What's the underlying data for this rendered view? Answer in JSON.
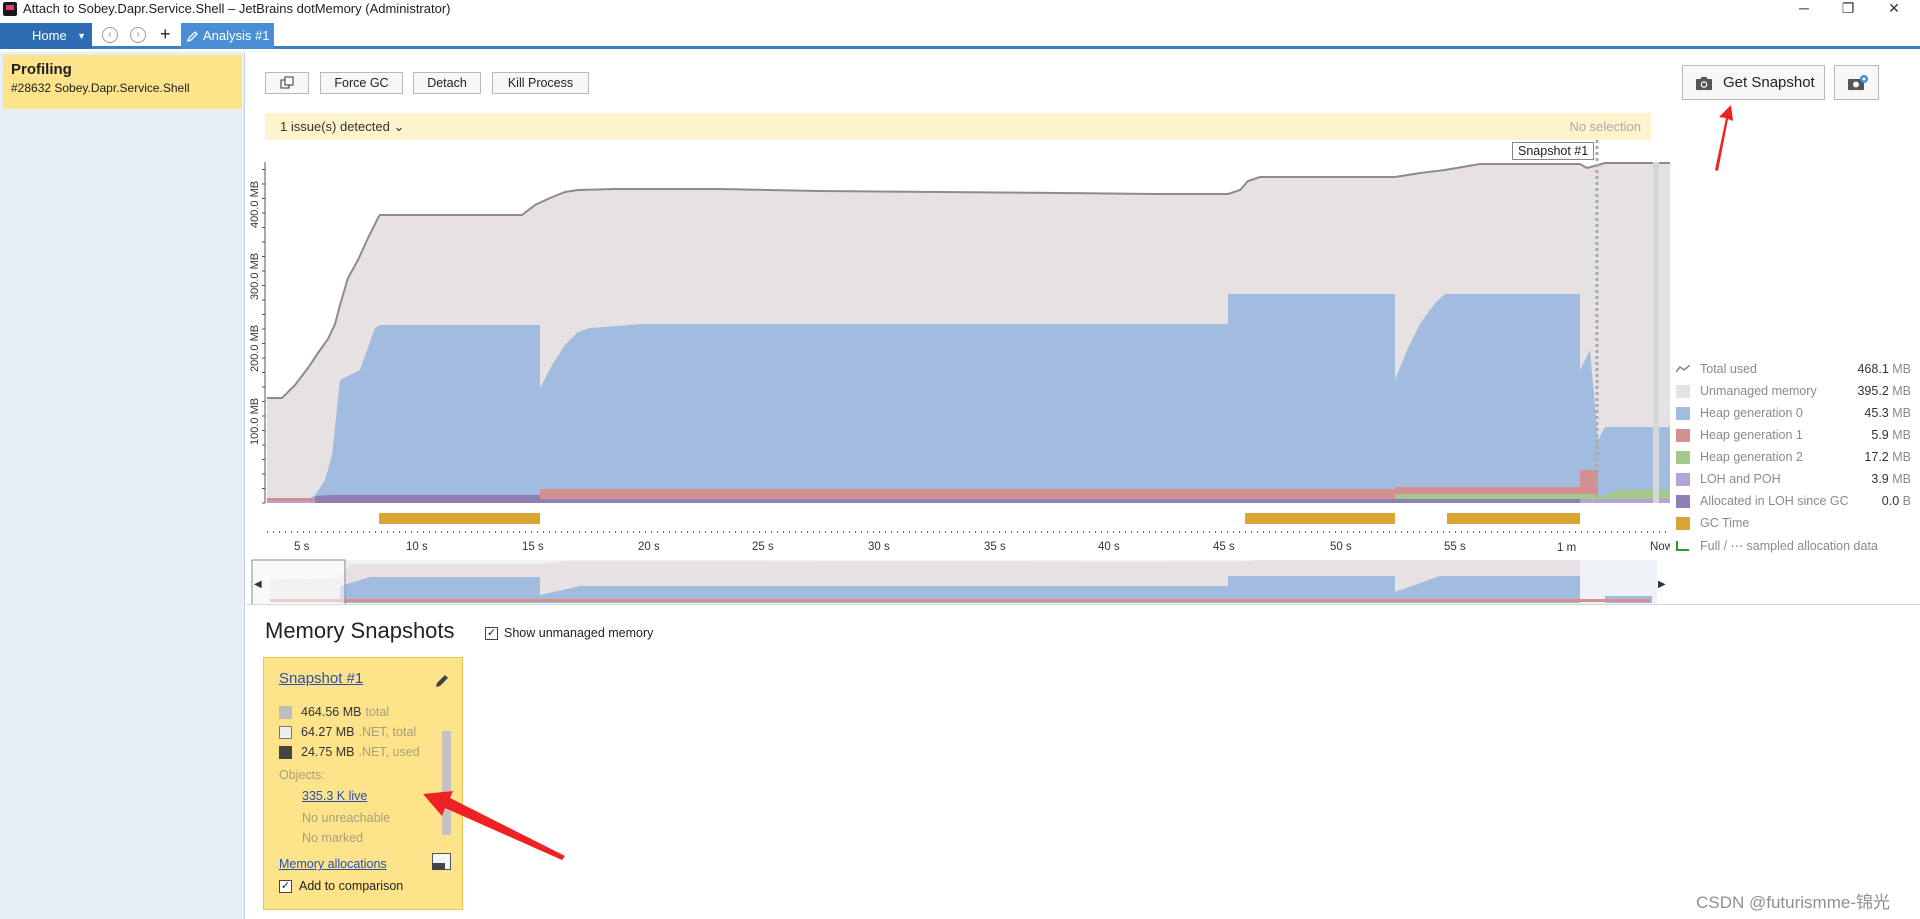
{
  "window": {
    "title": "Attach to Sobey.Dapr.Service.Shell – JetBrains dotMemory (Administrator)"
  },
  "tabs": {
    "home": "Home",
    "analysis": "Analysis #1"
  },
  "sidebar": {
    "card_title": "Profiling",
    "card_subtitle": "#28632 Sobey.Dapr.Service.Shell"
  },
  "toolbar": {
    "force_gc": "Force GC",
    "detach": "Detach",
    "kill_process": "Kill Process",
    "get_snapshot": "Get Snapshot"
  },
  "issues": {
    "detected": "1 issue(s) detected",
    "selection": "No selection"
  },
  "timeline": {
    "snapshot_marker": "Snapshot #1",
    "x_ticks": [
      "5 s",
      "10 s",
      "15 s",
      "20 s",
      "25 s",
      "30 s",
      "35 s",
      "40 s",
      "45 s",
      "50 s",
      "55 s",
      "1 m",
      "Now"
    ],
    "y_ticks": [
      "100.0 MB",
      "200.0 MB",
      "300.0 MB",
      "400.0 MB"
    ]
  },
  "legend": [
    {
      "label": "Total used",
      "value": "468.1",
      "unit": "MB",
      "color": "#8f8a8d"
    },
    {
      "label": "Unmanaged memory",
      "value": "395.2",
      "unit": "MB",
      "color": "#e6e1e3"
    },
    {
      "label": "Heap generation 0",
      "value": "45.3",
      "unit": "MB",
      "color": "#a2bcdf"
    },
    {
      "label": "Heap generation 1",
      "value": "5.9",
      "unit": "MB",
      "color": "#d48f91"
    },
    {
      "label": "Heap generation 2",
      "value": "17.2",
      "unit": "MB",
      "color": "#a4c98a"
    },
    {
      "label": "LOH and POH",
      "value": "3.9",
      "unit": "MB",
      "color": "#b3a3d8"
    },
    {
      "label": "Allocated in LOH since GC",
      "value": "0.0",
      "unit": "B",
      "color": "#8e7fb4"
    },
    {
      "label": "GC Time",
      "value": "",
      "unit": "",
      "color": "#dca432"
    },
    {
      "label": "Full / ⋯ sampled allocation data",
      "value": "",
      "unit": "",
      "color": "#2a9a2a"
    }
  ],
  "snapshots": {
    "title": "Memory Snapshots",
    "show_unmanaged": "Show unmanaged memory",
    "card": {
      "title": "Snapshot #1",
      "total_value": "464.56 MB",
      "total_label": "total",
      "net_total_value": "64.27 MB",
      "net_total_label": ".NET, total",
      "net_used_value": "24.75 MB",
      "net_used_label": ".NET, used",
      "objects_label": "Objects:",
      "live_link": "335.3 K live",
      "no_unreachable": "No unreachable",
      "no_marked": "No marked",
      "memory_allocations": "Memory allocations",
      "add_to_comparison": "Add to comparison"
    }
  },
  "watermark": "CSDN @futurismme-锦光"
}
